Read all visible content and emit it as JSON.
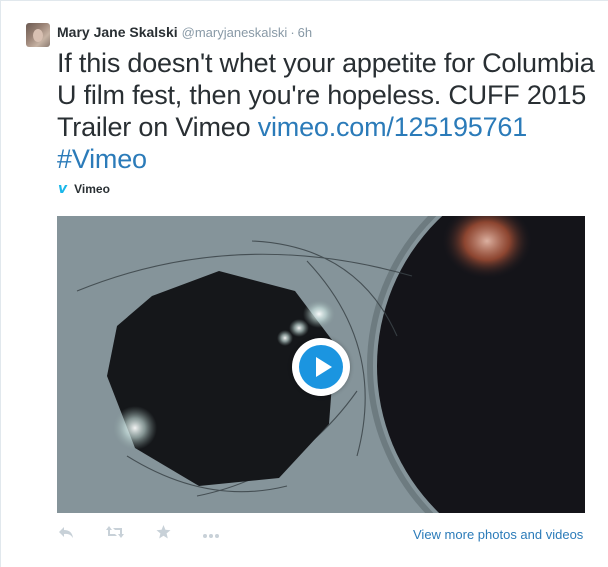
{
  "author": {
    "fullname": "Mary Jane Skalski",
    "username": "@maryjaneskalski",
    "separator": "·",
    "time": "6h"
  },
  "tweet": {
    "text_part1": "If this doesn't whet your appetite for Columbia U film fest, then you're hopeless. CUFF 2015 Trailer on Vimeo ",
    "link_url": "vimeo.com/125195761",
    "hashtag": "#Vimeo"
  },
  "card": {
    "provider_icon": "vimeo-icon",
    "provider": "Vimeo",
    "play_icon": "play-icon"
  },
  "actions": {
    "reply_icon": "reply-icon",
    "retweet_icon": "retweet-icon",
    "favorite_icon": "star-icon",
    "more_icon": "more-icon",
    "more_link": "View more photos and videos"
  },
  "colors": {
    "link": "#2b7bb9",
    "vimeo": "#1ab7ea",
    "play": "#1b95e0",
    "muted": "#8899a6"
  }
}
